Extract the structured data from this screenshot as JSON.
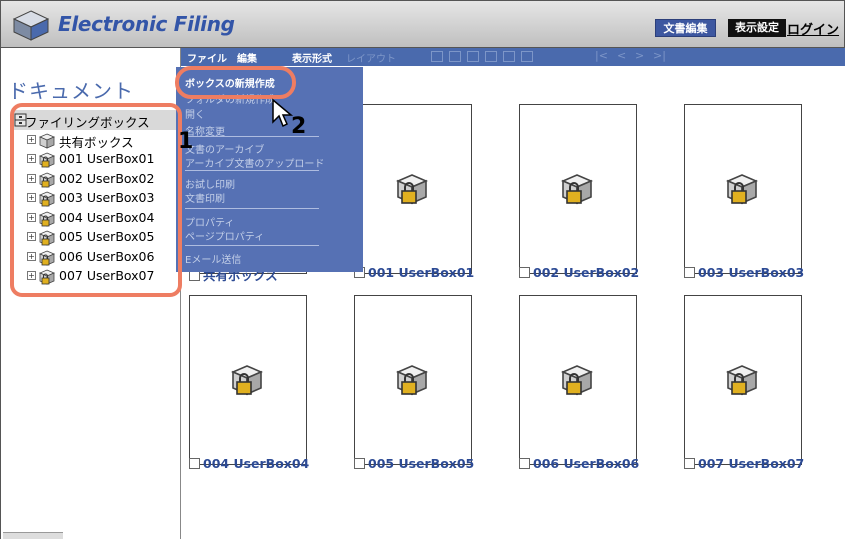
{
  "app": {
    "title": "Electronic Filing",
    "logo_icon": "cube-logo-icon"
  },
  "header": {
    "edit_label": "文書編集",
    "view_settings_label": "表示設定",
    "login_label": "ログイン"
  },
  "menubar": {
    "file": "ファイル",
    "edit": "編集",
    "display_format": "表示形式",
    "layout": "レイアウト",
    "nav": [
      "|<",
      "<",
      ">",
      ">|"
    ]
  },
  "sidebar": {
    "title": "ドキュメント",
    "root": {
      "label": "ファイリングボックス",
      "icon": "filing-cabinet-icon"
    },
    "items": [
      {
        "label": "共有ボックス",
        "icon": "shared-box-icon"
      },
      {
        "label": "001 UserBox01",
        "icon": "locked-box-icon"
      },
      {
        "label": "002 UserBox02",
        "icon": "locked-box-icon"
      },
      {
        "label": "003 UserBox03",
        "icon": "locked-box-icon"
      },
      {
        "label": "004 UserBox04",
        "icon": "locked-box-icon"
      },
      {
        "label": "005 UserBox05",
        "icon": "locked-box-icon"
      },
      {
        "label": "006 UserBox06",
        "icon": "locked-box-icon"
      },
      {
        "label": "007 UserBox07",
        "icon": "locked-box-icon"
      }
    ]
  },
  "dropdown": {
    "items": [
      {
        "label": "ボックスの新規作成",
        "enabled": true
      },
      {
        "label": "フォルダの新規作成",
        "enabled": false
      },
      {
        "label": "開く",
        "enabled": false
      },
      {
        "label": "名称変更",
        "enabled": false
      },
      {
        "label": "文書のアーカイブ",
        "enabled": false
      },
      {
        "label": "アーカイブ文書のアップロード",
        "enabled": false
      },
      {
        "label": "お試し印刷",
        "enabled": false
      },
      {
        "label": "文書印刷",
        "enabled": false
      },
      {
        "label": "プロパティ",
        "enabled": false
      },
      {
        "label": "ページプロパティ",
        "enabled": false
      },
      {
        "label": "Eメール送信",
        "enabled": false
      }
    ]
  },
  "callouts": {
    "step1": "1",
    "step2": "2"
  },
  "boxes": [
    {
      "label": "共有ボックス"
    },
    {
      "label": "001 UserBox01"
    },
    {
      "label": "002 UserBox02"
    },
    {
      "label": "003 UserBox03"
    },
    {
      "label": "004 UserBox04"
    },
    {
      "label": "005 UserBox05"
    },
    {
      "label": "006 UserBox06"
    },
    {
      "label": "007 UserBox07"
    }
  ],
  "colors": {
    "accent": "#4a6aad",
    "dropdown_bg": "#5671b4",
    "highlight": "#ee7d62",
    "link": "#2c4a94"
  }
}
